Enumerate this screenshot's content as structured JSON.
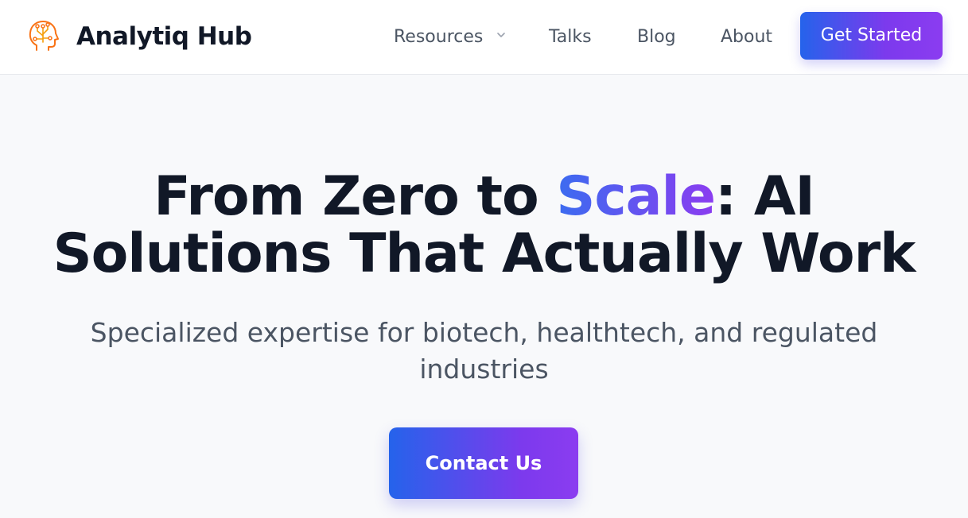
{
  "header": {
    "brand_name": "Analytiq Hub",
    "logo_icon": "ai-head-circuit-icon",
    "nav": {
      "resources": "Resources",
      "talks": "Talks",
      "blog": "Blog",
      "about": "About"
    },
    "cta_label": "Get Started"
  },
  "hero": {
    "title_before": "From Zero to ",
    "title_accent": "Scale",
    "title_after": ": AI Solutions That Actually Work",
    "subtitle": "Specialized expertise for biotech, healthtech, and regulated industries",
    "cta_label": "Contact Us"
  },
  "colors": {
    "accent_start": "#2563eb",
    "accent_end": "#8b3cf0",
    "text_dark": "#111827",
    "text_muted": "#4b5563",
    "logo_orange": "#f97316"
  }
}
